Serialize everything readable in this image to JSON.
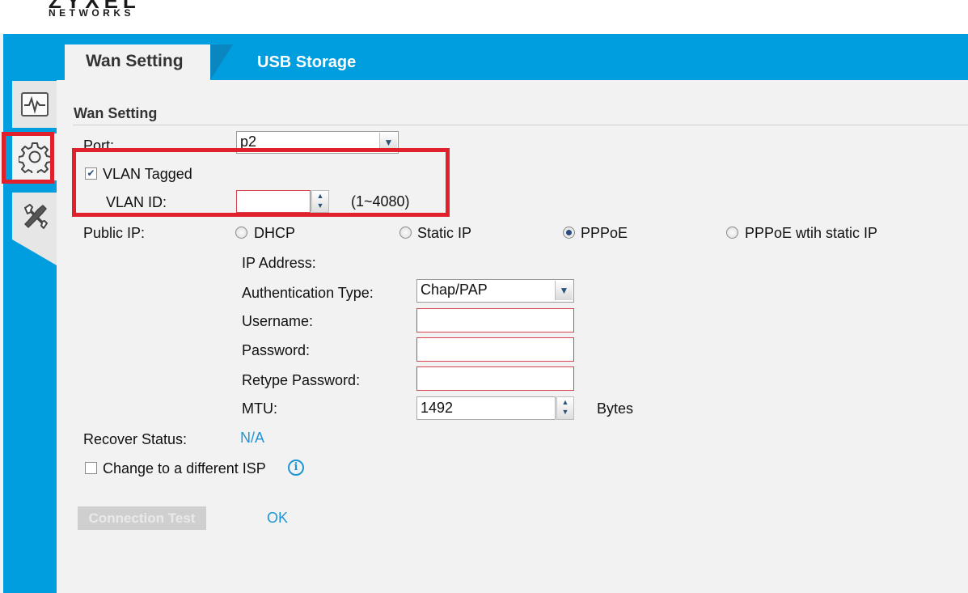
{
  "brand": {
    "logo_main": "ZYXEL",
    "logo_sub": "NETWORKS"
  },
  "tabs": [
    {
      "label": "Wan Setting",
      "active": true
    },
    {
      "label": "USB Storage",
      "active": false
    }
  ],
  "sidebar": {
    "items": [
      {
        "icon": "activity-monitor-icon",
        "selected": false
      },
      {
        "icon": "gear-icon",
        "selected": true
      },
      {
        "icon": "tools-icon",
        "selected": false
      }
    ]
  },
  "section": {
    "title": "Wan Setting"
  },
  "form": {
    "port_label": "Port:",
    "port_value": "p2",
    "vlan_tagged_label": "VLAN Tagged",
    "vlan_tagged_checked": true,
    "vlan_id_label": "VLAN ID:",
    "vlan_id_value": "",
    "vlan_id_range": "(1~4080)",
    "public_ip_label": "Public IP:",
    "public_ip_options": [
      "DHCP",
      "Static IP",
      "PPPoE",
      "PPPoE wtih static IP"
    ],
    "public_ip_selected": "PPPoE",
    "ip_address_label": "IP Address:",
    "auth_type_label": "Authentication Type:",
    "auth_type_value": "Chap/PAP",
    "username_label": "Username:",
    "username_value": "",
    "password_label": "Password:",
    "password_value": "",
    "retype_password_label": "Retype Password:",
    "retype_password_value": "",
    "mtu_label": "MTU:",
    "mtu_value": "1492",
    "mtu_unit": "Bytes",
    "recover_status_label": "Recover Status:",
    "recover_status_value": "N/A",
    "change_isp_label": "Change to a different ISP",
    "change_isp_checked": false
  },
  "buttons": {
    "connection_test": "Connection Test",
    "ok": "OK"
  },
  "colors": {
    "brand_blue": "#009ddf",
    "highlight_red": "#e0202a",
    "link_blue": "#1e96d6",
    "panel_bg": "#f2f2f2"
  }
}
